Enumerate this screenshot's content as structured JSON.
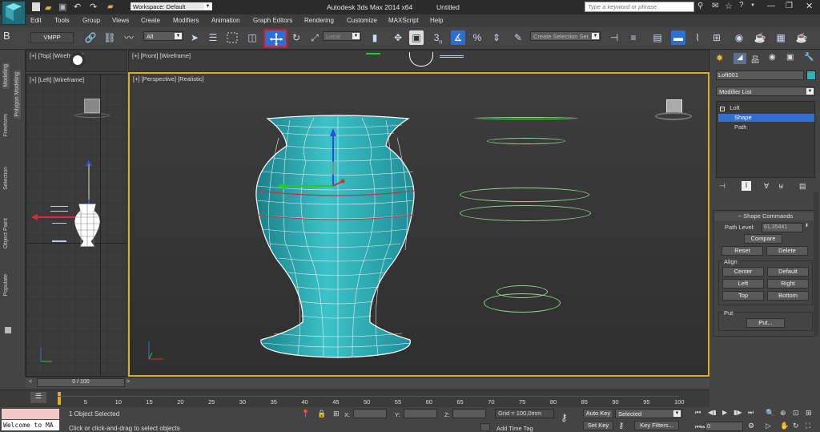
{
  "title_bar": {
    "workspace_label": "Workspace: Default",
    "app_title": "Autodesk 3ds Max  2014 x64",
    "doc_title": "Untitled",
    "search_placeholder": "Type a keyword or phrase"
  },
  "menu": [
    "Edit",
    "Tools",
    "Group",
    "Views",
    "Create",
    "Modifiers",
    "Animation",
    "Graph Editors",
    "Rendering",
    "Customize",
    "MAXScript",
    "Help"
  ],
  "toolbar": {
    "vmpp": "VMPP",
    "filter_value": "All",
    "coord_value": "Local",
    "selection_set_placeholder": "Create Selection Set",
    "snap_label": "3",
    "snap_sub": "n",
    "angle_label": "%",
    "highlighted_tool": "select-and-move",
    "highlight_color": "#e0141c"
  },
  "left_tabs": [
    "Modeling",
    "Polygon Modeling",
    "Freeform",
    "Selection",
    "Object Paint",
    "Populate"
  ],
  "viewports": {
    "top": "[+] [Top] [Wireframe]",
    "front": "[+] [Front] [Wireframe]",
    "left": "[+] [Left] [Wireframe]",
    "perspective": "[+] [Perspective] [Realistic]"
  },
  "command_panel": {
    "object_name": "Loft001",
    "object_color": "#2fb3b7",
    "modifier_list": "Modifier List",
    "stack": [
      "Loft",
      "Shape",
      "Path"
    ],
    "selected_item": "Shape",
    "rollout_title": "Shape Commands",
    "path_level_label": "Path Level:",
    "path_level_value": "61,35441",
    "compare": "Compare",
    "reset": "Reset",
    "delete": "Delete",
    "align_label": "Align",
    "center": "Center",
    "default": "Default",
    "left": "Left",
    "right": "Right",
    "top": "Top",
    "bottom": "Bottom",
    "put_label": "Put",
    "put_button": "Put..."
  },
  "timeline": {
    "frame_display": "0 / 100",
    "ticks": [
      "5",
      "10",
      "15",
      "20",
      "25",
      "30",
      "35",
      "40",
      "45",
      "50",
      "55",
      "60",
      "65",
      "70",
      "75",
      "80",
      "85",
      "90",
      "95",
      "100"
    ]
  },
  "status": {
    "listener": "Welcome to MA",
    "selected": "1 Object Selected",
    "prompt": "Click or click-and-drag to select objects",
    "x_label": "X:",
    "y_label": "Y:",
    "z_label": "Z:",
    "grid": "Grid = 100,0mm",
    "add_time_tag": "Add Time Tag",
    "auto_key": "Auto Key",
    "set_key": "Set Key",
    "key_mode": "Selected",
    "key_filters": "Key Filters...",
    "frame_value": "0"
  }
}
